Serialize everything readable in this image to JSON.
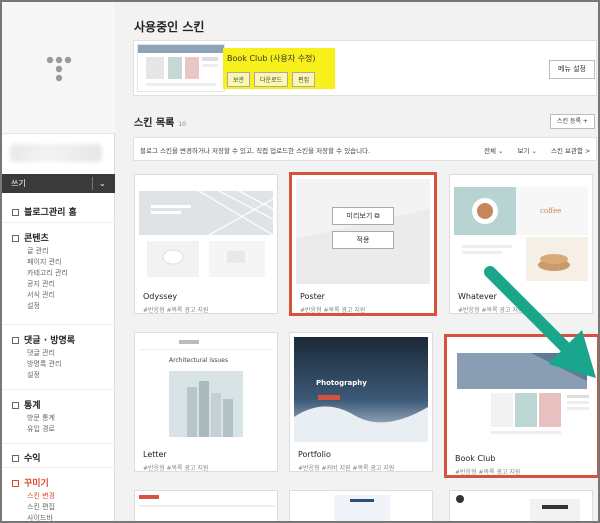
{
  "sidebar": {
    "write_label": "쓰기",
    "home_label": "블로그관리 홈",
    "sections": [
      {
        "title": "콘텐츠",
        "items": [
          "글 관리",
          "페이지 관리",
          "카테고리 관리",
          "공지 관리",
          "서식 관리",
          "설정"
        ]
      },
      {
        "title": "댓글 · 방명록",
        "items": [
          "댓글 관리",
          "방명록 관리",
          "설정"
        ]
      },
      {
        "title": "통계",
        "items": [
          "방문 통계",
          "유입 경로"
        ]
      },
      {
        "title": "수익",
        "items": []
      },
      {
        "title": "꾸미기",
        "items": [
          "스킨 변경",
          "스킨 편집",
          "사이드바"
        ]
      }
    ]
  },
  "current": {
    "heading": "사용중인 스킨",
    "skin_name": "Book Club (사용자 수정)",
    "buttons": [
      "보관",
      "다운로드",
      "편집"
    ],
    "right_button": "메뉴 설정"
  },
  "list": {
    "heading": "스킨 목록",
    "count": "10",
    "store_button": "스킨 등록 +",
    "info": "블로그 스킨을 변경하거나 저장할 수 있고, 직접 업로드한 스킨을 저장할 수 있습니다.",
    "controls": [
      "전체",
      "보기",
      "스킨 보관함 >"
    ]
  },
  "skins": [
    {
      "name": "Odyssey",
      "tags": "#반응형   #목록 광고 지원"
    },
    {
      "name": "Poster",
      "tags": "#반응형   #목록 광고 지원",
      "overlay_preview": "미리보기",
      "overlay_apply": "적용"
    },
    {
      "name": "Whatever",
      "tags": "#반응형   #목록 광고 지원",
      "brand": "coffee"
    },
    {
      "name": "Letter",
      "tags": "#반응형   #목록 광고 지원",
      "caption": "Architectural issues"
    },
    {
      "name": "Portfolio",
      "tags": "#반응형   #커버 지원   #목록 광고 지원",
      "caption": "Photography"
    },
    {
      "name": "Book Club",
      "tags": "#반응형   #목록 광고 지원"
    }
  ],
  "colors": {
    "highlight": "#d6523e",
    "yellow": "#f7f01a",
    "arrow": "#1aa68c",
    "accent": "#e5472d"
  }
}
